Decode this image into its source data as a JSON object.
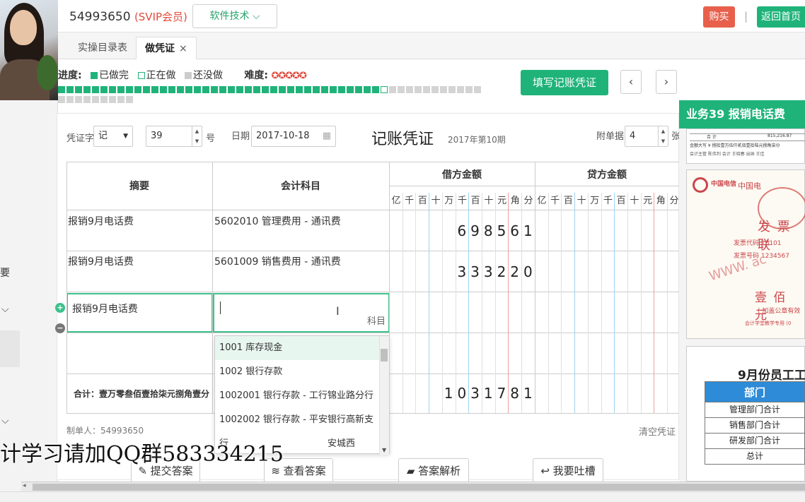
{
  "header": {
    "user_id": "54993650",
    "vip_label": "(SVIP会员)",
    "dropdown_label": "软件技术 ⌵",
    "buy_label": "购买",
    "separator": "|",
    "home_label": "返回首页"
  },
  "tabs": [
    {
      "label": "实操目录表"
    },
    {
      "label": "做凭证",
      "close": "×"
    }
  ],
  "progress": {
    "label": "进度:",
    "done_label": "已做完",
    "doing_label": "正在做",
    "todo_label": "还没做",
    "difficulty_label": "难度:",
    "difficulty_stars": "✪✪✪✪✪",
    "total": 59,
    "done": 38,
    "current": 39
  },
  "buttons": {
    "fill_voucher": "填写记账凭证",
    "prev": "‹",
    "next": "›",
    "answer_analysis": "答案解析",
    "feedback": "我要吐槽",
    "submit_answer": "提交答案",
    "view_answer": "查看答案"
  },
  "voucher": {
    "word_label": "凭证字",
    "word_value": "记",
    "number_value": "39",
    "number_suffix": "号",
    "date_label": "日期",
    "date_value": "2017-10-18",
    "title": "记账凭证",
    "period": "2017年第10期",
    "attach_label": "附单据",
    "attach_value": "4",
    "attach_suffix": "张",
    "col_summary": "摘要",
    "col_account": "会计科目",
    "col_debit": "借方金额",
    "col_credit": "贷方金额",
    "digit_headers": [
      "亿",
      "千",
      "百",
      "十",
      "万",
      "千",
      "百",
      "十",
      "元",
      "角",
      "分"
    ],
    "rows": [
      {
        "summary": "报销9月电话费",
        "account": "5602010 管理费用 - 通讯费",
        "debit_digits": [
          "6",
          "9",
          "8",
          "5",
          "6",
          "1"
        ]
      },
      {
        "summary": "报销9月电话费",
        "account": "5601009 销售费用 - 通讯费",
        "debit_digits": [
          "3",
          "3",
          "3",
          "2",
          "2",
          "0"
        ]
      },
      {
        "summary": "报销9月电话费",
        "account": "",
        "account_hint": "科目",
        "debit_digits": []
      }
    ],
    "total_label": "合计：壹万零叁佰壹拾柒元捌角壹分",
    "total_digits": [
      "1",
      "0",
      "3",
      "1",
      "7",
      "8",
      "1"
    ],
    "maker_label": "制单人：54993650",
    "clear_label": "清空凭证"
  },
  "account_dropdown": [
    {
      "label": "1001 库存现金",
      "highlight": true
    },
    {
      "label": "1002 银行存款"
    },
    {
      "label": "1002001 银行存款 - 工行锦业路分行"
    },
    {
      "label": "1002002 银行存款 - 平安银行高新支行"
    },
    {
      "label": "安城西"
    }
  ],
  "right_panel": {
    "title": "业务39 报销电话费",
    "receipt_row_label": "合   计",
    "receipt_row_amount": "815,216.87",
    "receipt_words": "金额大写 ¥ 捌拾壹万伍仟贰佰壹拾陆元捌角柒分",
    "receipt_signers": "会计主管 陈伟列      会计 王晓春      出纳 王佳",
    "invoice_logo": "中国电信",
    "invoice_brand": "中国电",
    "invoice_title": "发 票 联",
    "invoice_code": "发票代码 16101",
    "invoice_number": "发票号码 1234567",
    "invoice_watermark": "WWW. ac",
    "invoice_amount": "壹 佰 元",
    "invoice_note1": "( 加盖公章有效",
    "invoice_note2": "会计学堂教学专用 (0",
    "salary_title": "9月份员工工",
    "salary_header": "部门",
    "salary_rows": [
      "管理部门合计",
      "销售部门合计",
      "研发部门合计",
      "总计"
    ]
  },
  "left_strip": {
    "glyph": "要"
  },
  "subtitle": "计学习请加QQ群583334215",
  "colors": {
    "accent": "#1fb37a",
    "danger": "#e8604c",
    "highlight_border": "#3cc28b"
  }
}
